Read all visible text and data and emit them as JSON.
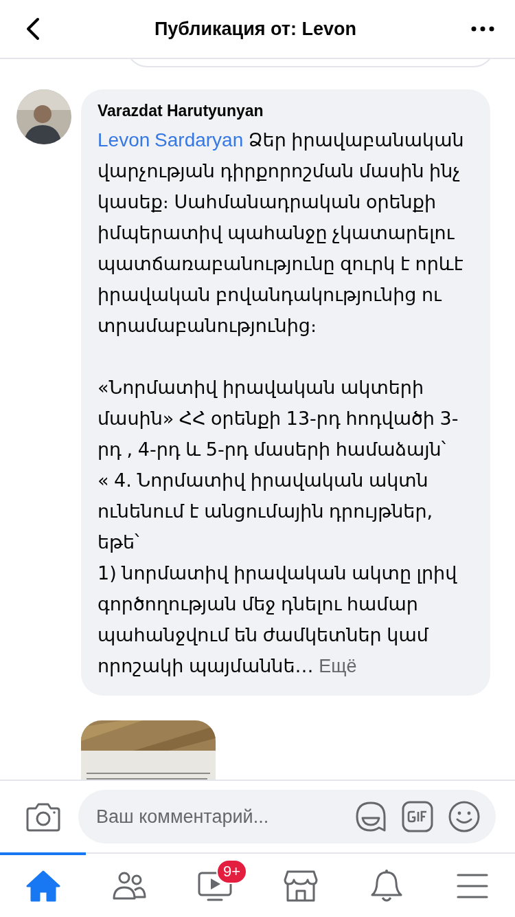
{
  "header": {
    "title": "Публикация от: Levon"
  },
  "comment": {
    "author": "Varazdat Harutyunyan",
    "mention": "Levon Sardaryan",
    "text": "Ձեր իրավաբանական վարչության դիրքորոշման մասին ինչ կասեք։ Սահմանադրական օրենքի իմպերատիվ պահանջը չկատարելու պատճառաբանությունը զուրկ է որևէ իրավական բովանդակությունից ու տրամաբանությունից։\n\n«Նորմատիվ իրավական ակտերի մասին» ՀՀ օրենքի 13-րդ հոդվածի 3-րդ , 4-րդ և 5-րդ մասերի համաձայն՝\n« 4. Նորմատիվ իրավական ակտն ունենում է անցումային դրույթներ, եթե՝\n1) նորմատիվ իրավական ակտը լրիվ գործողության մեջ դնելու համար պահանջվում են ժամկետներ կամ որոշակի պայմաննե…",
    "more": "Ещё"
  },
  "composer": {
    "placeholder": "Ваш комментарий..."
  },
  "tabs": [
    {
      "kind": "home",
      "selected": true
    },
    {
      "kind": "friends",
      "selected": false
    },
    {
      "kind": "video",
      "selected": false,
      "badge": "9+"
    },
    {
      "kind": "shop",
      "selected": false
    },
    {
      "kind": "bell",
      "selected": false
    },
    {
      "kind": "menu",
      "selected": false
    }
  ]
}
